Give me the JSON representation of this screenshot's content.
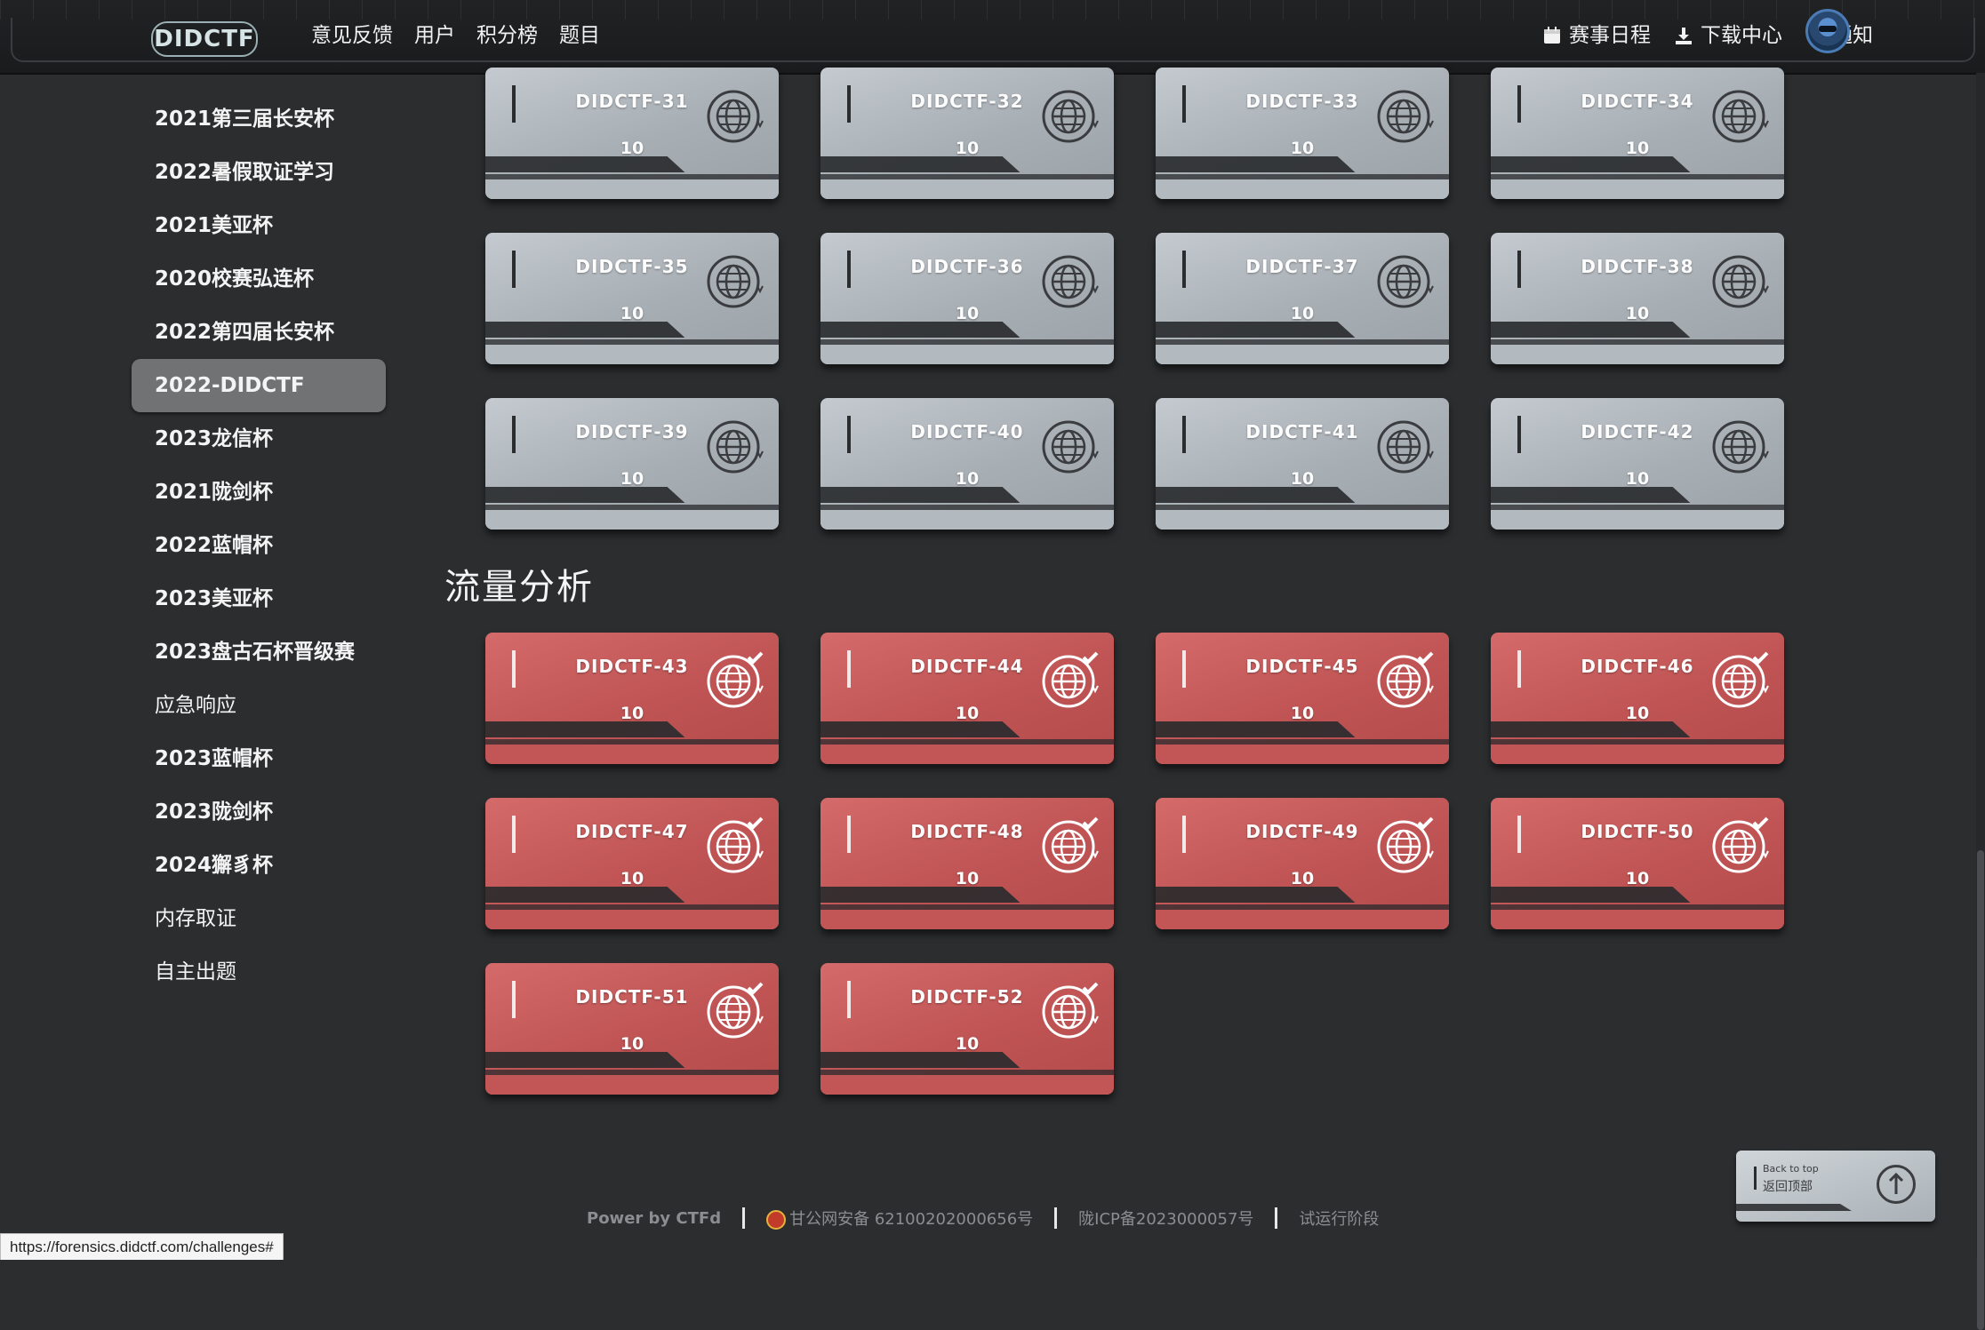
{
  "navbar": {
    "logo": "DIDCTF",
    "links": [
      "意见反馈",
      "用户",
      "积分榜",
      "题目"
    ],
    "right_items": [
      {
        "icon": "calendar-icon",
        "label": "赛事日程"
      },
      {
        "icon": "download-icon",
        "label": "下载中心"
      },
      {
        "icon": "bell-icon",
        "label": "通知"
      }
    ]
  },
  "sidebar": {
    "items": [
      {
        "label": "2021第三届长安杯"
      },
      {
        "label": "2022暑假取证学习"
      },
      {
        "label": "2021美亚杯"
      },
      {
        "label": "2020校赛弘连杯"
      },
      {
        "label": "2022第四届长安杯"
      },
      {
        "label": "2022-DIDCTF",
        "active": true
      },
      {
        "label": "2023龙信杯"
      },
      {
        "label": "2021陇剑杯"
      },
      {
        "label": "2022蓝帽杯"
      },
      {
        "label": "2023美亚杯"
      },
      {
        "label": "2023盘古石杯晋级赛"
      },
      {
        "label": "应急响应"
      },
      {
        "label": "2023蓝帽杯"
      },
      {
        "label": "2023陇剑杯"
      },
      {
        "label": "2024獬豸杯"
      },
      {
        "label": "内存取证"
      },
      {
        "label": "自主出题"
      }
    ]
  },
  "challenges_grey": [
    {
      "name": "DIDCTF-31",
      "value": "10"
    },
    {
      "name": "DIDCTF-32",
      "value": "10"
    },
    {
      "name": "DIDCTF-33",
      "value": "10"
    },
    {
      "name": "DIDCTF-34",
      "value": "10"
    },
    {
      "name": "DIDCTF-35",
      "value": "10"
    },
    {
      "name": "DIDCTF-36",
      "value": "10"
    },
    {
      "name": "DIDCTF-37",
      "value": "10"
    },
    {
      "name": "DIDCTF-38",
      "value": "10"
    },
    {
      "name": "DIDCTF-39",
      "value": "10"
    },
    {
      "name": "DIDCTF-40",
      "value": "10"
    },
    {
      "name": "DIDCTF-41",
      "value": "10"
    },
    {
      "name": "DIDCTF-42",
      "value": "10"
    }
  ],
  "category": {
    "title": "流量分析"
  },
  "challenges_red": [
    {
      "name": "DIDCTF-43",
      "value": "10"
    },
    {
      "name": "DIDCTF-44",
      "value": "10"
    },
    {
      "name": "DIDCTF-45",
      "value": "10"
    },
    {
      "name": "DIDCTF-46",
      "value": "10"
    },
    {
      "name": "DIDCTF-47",
      "value": "10"
    },
    {
      "name": "DIDCTF-48",
      "value": "10"
    },
    {
      "name": "DIDCTF-49",
      "value": "10"
    },
    {
      "name": "DIDCTF-50",
      "value": "10"
    },
    {
      "name": "DIDCTF-51",
      "value": "10"
    },
    {
      "name": "DIDCTF-52",
      "value": "10"
    }
  ],
  "colors": {
    "solved_card": "#c05454",
    "unsolved_card": "#a7aeb4",
    "background": "#2b2d2f"
  },
  "footer": {
    "powered": "Power by CTFd",
    "police": "甘公网安备 62100202000656号",
    "icp": "陇ICP备2023000057号",
    "stage": "试运行阶段"
  },
  "back_to_top": {
    "en": "Back to top",
    "zh": "返回顶部"
  },
  "status_url": "https://forensics.didctf.com/challenges#"
}
